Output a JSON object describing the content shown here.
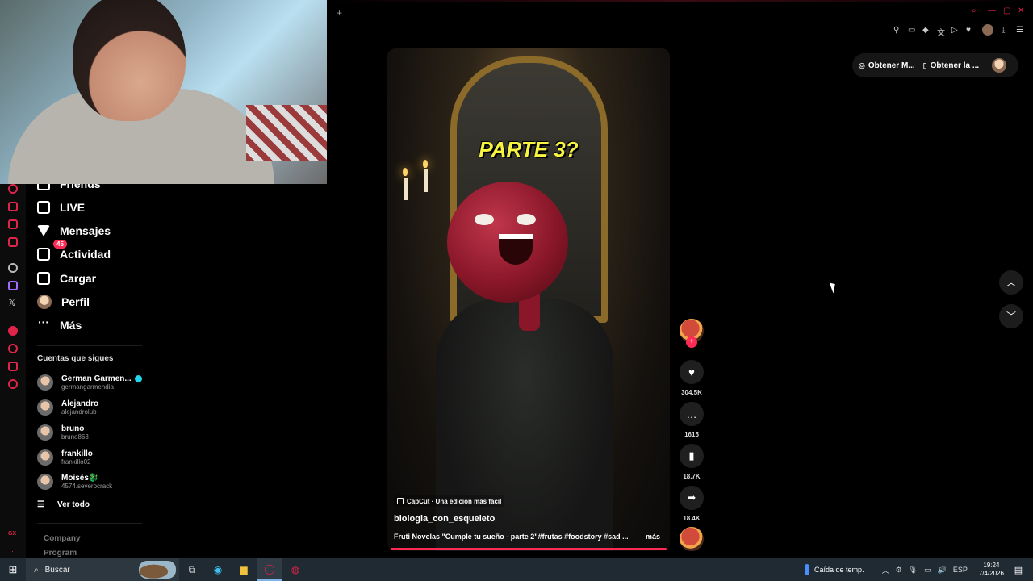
{
  "sidebar": {
    "nav": [
      {
        "label": "Friends"
      },
      {
        "label": "LIVE"
      },
      {
        "label": "Mensajes"
      },
      {
        "label": "Actividad",
        "badge": "45"
      },
      {
        "label": "Cargar"
      },
      {
        "label": "Perfil"
      },
      {
        "label": "Más"
      }
    ],
    "following_title": "Cuentas que sigues",
    "following": [
      {
        "name": "German Garmen...",
        "handle": "germangarmendia",
        "verified": true
      },
      {
        "name": "Alejandro",
        "handle": "alejandrolub"
      },
      {
        "name": "bruno",
        "handle": "bruno863"
      },
      {
        "name": "frankillo",
        "handle": "frankillo02"
      },
      {
        "name": "Moisés🐉",
        "handle": "4574.severocrack"
      }
    ],
    "see_all": "Ver todo",
    "footer": [
      "Company",
      "Program"
    ]
  },
  "header": {
    "get_points": "Obtener M...",
    "get_app": "Obtener la ..."
  },
  "video": {
    "overlay_title": "PARTE 3?",
    "capcut_label": "CapCut · Una edición más fácil",
    "author": "biologia_con_esqueleto",
    "description": "Fruti Novelas \"Cumple tu sueño - parte 2\"#frutas #foodstory #sad ...",
    "more": "más",
    "progress": 1.0
  },
  "actions": {
    "likes": "304.5K",
    "comments": "1615",
    "saves": "18.7K",
    "shares": "18.4K"
  },
  "rail": {
    "bottom_label": "GX"
  },
  "taskbar": {
    "search_label": "Buscar",
    "weather": "Caída de temp.",
    "lang": "ESP",
    "time": "19:24",
    "date": "7/4/2026"
  },
  "colors": {
    "accent": "#fe2c55",
    "opera_red": "#e0244a",
    "taskbar": "#1f2a33"
  }
}
